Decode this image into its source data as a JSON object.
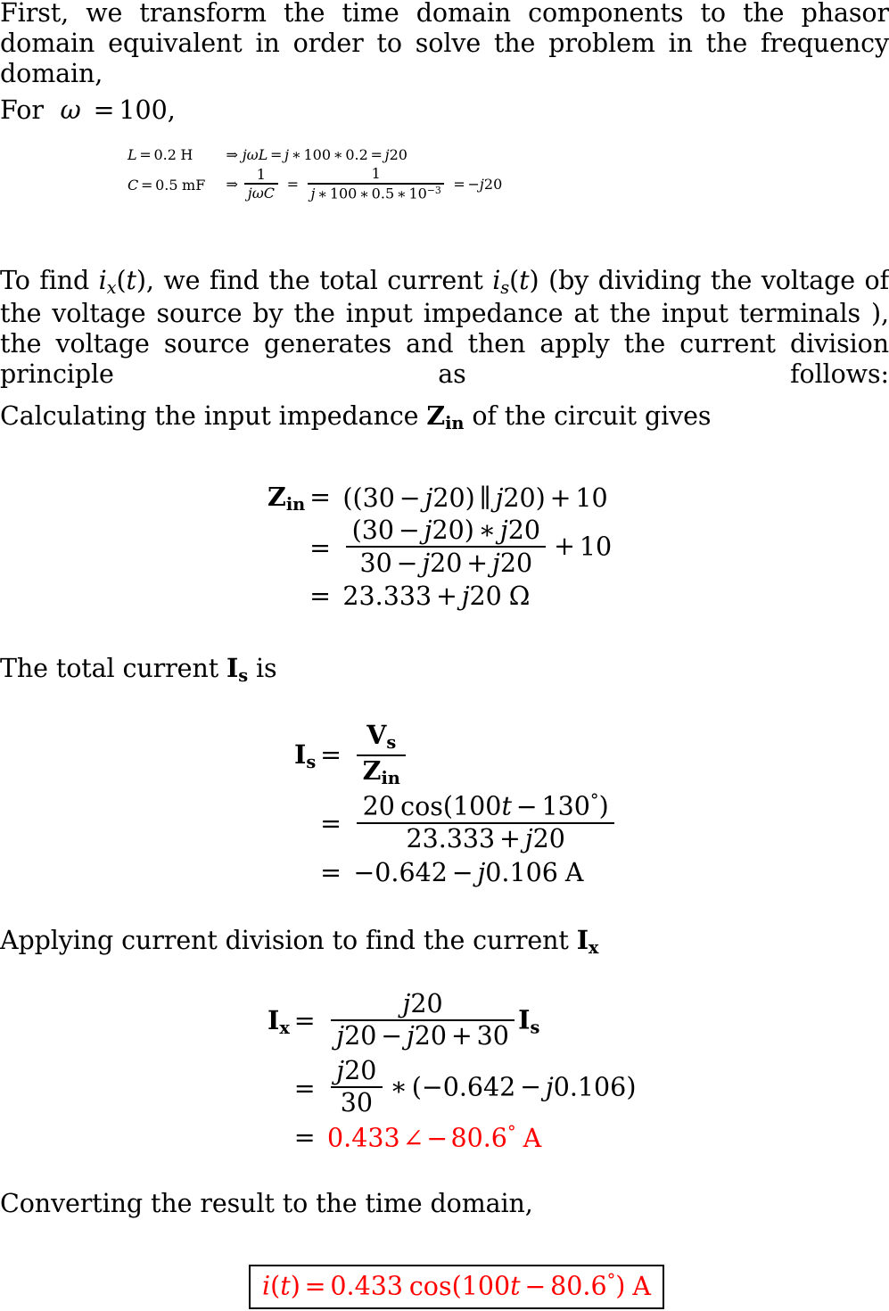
{
  "document": {
    "type": "worked-solution",
    "topic": "AC circuit phasor analysis",
    "accent_color": "#FF0000",
    "text_color": "#000000",
    "background_color": "#FFFFFF"
  },
  "paragraphs": {
    "intro": "First, we transform the time domain components to the phasor domain equivalent in order to solve the problem in the frequency domain,",
    "for_omega_prefix": "For",
    "for_omega_math": "ω = 100,",
    "find_ix": "To find i_x(t), we find the total current i_s(t) (by dividing the voltage of the voltage source by the input impedance at the input terminals ), the voltage source generates and then apply the current division principle as follows:",
    "find_ix_part1": "To find",
    "find_ix_part2": ", we find the total current",
    "find_ix_part3": "(by dividing the voltage of the voltage source by the input impedance at the input terminals ), the voltage source generates and then apply the current division principle as follows:",
    "calc_zin_part1": "Calculating the input impedance",
    "calc_zin_part2": "of the circuit gives",
    "total_current_part1": "The total current",
    "total_current_part2": "is",
    "current_division_part1": "Applying current division to find the current",
    "converting": "Converting the result to the time domain,"
  },
  "symbols": {
    "omega": "ω",
    "equals": "=",
    "implies": "⇒",
    "times": "∗",
    "plus": "+",
    "minus": "−",
    "parallel": "∥",
    "angle": "∠",
    "ohm": "Ω",
    "degree": "°",
    "j": "j",
    "t": "t",
    "L": "L",
    "C": "C",
    "Z": "Z",
    "I": "I",
    "V": "V",
    "i": "i",
    "x": "x",
    "s": "s",
    "in": "in",
    "cos": "cos",
    "A": "A",
    "H": "H",
    "mF": "mF"
  },
  "equations": {
    "omega_value": "100",
    "inductor": {
      "label_L": "L",
      "value": "0.2",
      "unit": "H",
      "impedance_expr_jwL": "jωL",
      "calc_j": "j",
      "calc_omega": "100",
      "calc_L": "0.2",
      "result": "j20",
      "result_mag": "20"
    },
    "capacitor": {
      "label_C": "C",
      "value": "0.5",
      "unit": "mF",
      "one": "1",
      "denom_expr": "jωC",
      "calc_j": "j",
      "calc_omega": "100",
      "calc_C": "0.5",
      "calc_scale_base": "10",
      "calc_scale_exp": "−3",
      "result": "−j20",
      "result_mag": "20"
    },
    "zin": {
      "name": "Z",
      "sub": "in",
      "line1": "((30 − j20) ∥ j20) + 10",
      "line1_r1": "30",
      "line1_r2": "20",
      "line1_r3": "20",
      "line1_r4": "10",
      "line2_num": "(30 − j20) ∗ j20",
      "line2_num_a": "30",
      "line2_num_b": "20",
      "line2_num_c": "20",
      "line2_den": "30 − j20 + j20",
      "line2_den_a": "30",
      "line2_den_b": "20",
      "line2_den_c": "20",
      "line2_add": "10",
      "line3_real": "23.333",
      "line3_imag": "20",
      "line3_unit": "Ω"
    },
    "is": {
      "name": "I",
      "sub": "s",
      "num_sym": "V",
      "num_sub": "s",
      "den_sym": "Z",
      "den_sub": "in",
      "num2_amp": "20",
      "num2_cos": "cos",
      "num2_omega_t": "100",
      "num2_t": "t",
      "num2_phase": "130",
      "num2_degree": "°",
      "den2_real": "23.333",
      "den2_imag": "20",
      "result_real": "0.642",
      "result_imag": "0.106",
      "result_unit": "A"
    },
    "ix": {
      "name": "I",
      "sub": "x",
      "num": "j20",
      "num_mag": "20",
      "den": "j20 − j20 + 30",
      "den_a": "20",
      "den_b": "20",
      "den_c": "30",
      "mult_sym": "I",
      "mult_sub": "s",
      "line2_num": "j20",
      "line2_num_mag": "20",
      "line2_den": "30",
      "line2_val_real": "0.642",
      "line2_val_imag": "0.106",
      "result_mag": "0.433",
      "result_angle": "80.6",
      "result_degree": "°",
      "result_unit": "A"
    },
    "final": {
      "lhs_sym": "i",
      "lhs_var": "t",
      "amplitude": "0.433",
      "cos": "cos",
      "omega": "100",
      "var": "t",
      "phase": "80.6",
      "degree": "°",
      "unit": "A"
    }
  }
}
